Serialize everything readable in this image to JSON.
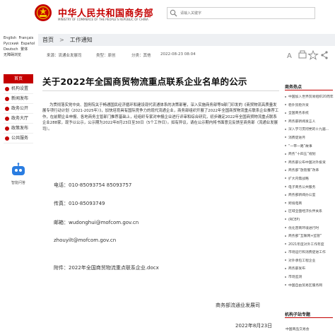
{
  "header": {
    "site_title_cn": "中华人民共和国商务部",
    "site_title_en": "MINISTRY OF COMMERCE OF THE PEOPLE'S REPUBLIC OF CHINA",
    "search_placeholder": "请输入关键字",
    "brand_color": "#c40000"
  },
  "languages": [
    "English",
    "Français",
    "Русский",
    "Español",
    "Deutsch",
    "繁体",
    "无障碍浏览"
  ],
  "nav": [
    {
      "label": "首页",
      "active": true
    },
    {
      "label": "机构设置",
      "active": false
    },
    {
      "label": "新闻发布",
      "active": false
    },
    {
      "label": "政务公开",
      "active": false
    },
    {
      "label": "政务大厅",
      "active": false
    },
    {
      "label": "政策发布",
      "active": false
    },
    {
      "label": "公共服务",
      "active": false
    }
  ],
  "robot_label": "智能问答",
  "breadcrumb": {
    "home": "首页",
    "separator": ">",
    "current": "工作通知"
  },
  "meta": {
    "source": "来源：流通业发展司",
    "category": "类型：原创",
    "classification": "分类：其他",
    "date": "2022-08-23 08:04"
  },
  "article": {
    "title": "关于2022年全国商贸物流重点联系企业名单的公示",
    "paragraph1": "为贯彻落实党中央、国务院关于畅通国民经济循环和建设现代流通体系的决策部署，深入实施商务部等9部门印发的《商贸物流高质量发展专项行动计划（2021-2025年）》，加快培育具有国际竞争力的现代流通企业，商务部组织开展了2022年全国商贸物流重点联系企业推荐工作，在前期企业申报、各地商务主管部门推荐基础上，经组织专家对申报企业进行评审和综合研究，初步确定2022年全国商贸物流重点联系企业288家，现予以公示，公示期为2022年8月23日至30日（5个工作日）。如有异议，请在公示期内将书面意见反馈至商务部（流通业发展司）。",
    "phone_label": "电话：",
    "phone": "010-85093754 85093757",
    "fax_label": "传真：",
    "fax": "010-85093749",
    "email_label": "邮箱：",
    "email1": "wudonghui@mofcom.gov.cn",
    "email2": "zhouyilt@mofcom.gov.cn",
    "attachment_label": "附件：",
    "attachment": "2022年全国商贸物流重点联系企业.docx",
    "signer": "商务部流通业发展司",
    "sign_date": "2022年8月23日"
  },
  "aside": {
    "hot_title": "商务热点",
    "hot_items": [
      "中国加入世界贸易组织20周年",
      "稳外贸稳外资",
      "全国商务系统",
      "商务部新闻发言人",
      "深入学习贯彻党的十九届...",
      "消费促进月",
      "“一带一路”故事",
      "商务“十四五”规划",
      "商务部公布中国对外投资",
      "商务部“放管服”改革",
      "扩大内需战略",
      "电子商务公共服务",
      "商务部新闻办公室",
      "跨境电商",
      "区域全面经济伙伴关系",
      "(RCEP)",
      "优化营商环境进行时",
      "商务部“互联网+监管”",
      "2021年度对外工作年度",
      "市场运行和消费促进工作",
      "对外承包工程企业",
      "商务部发布",
      "市场监测",
      "中国自由贸易区服务网"
    ],
    "sub_title": "机构子站专题",
    "bottom_item": "中国商品交易会"
  }
}
